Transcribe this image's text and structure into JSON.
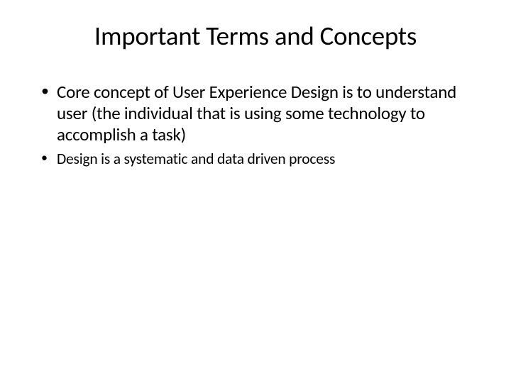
{
  "slide": {
    "title": "Important Terms and Concepts",
    "bullets": {
      "item1": "Core concept of User Experience Design is to understand user (the individual that is using some technology to accomplish a task)",
      "item2": "Design is a systematic  and data driven process"
    }
  }
}
